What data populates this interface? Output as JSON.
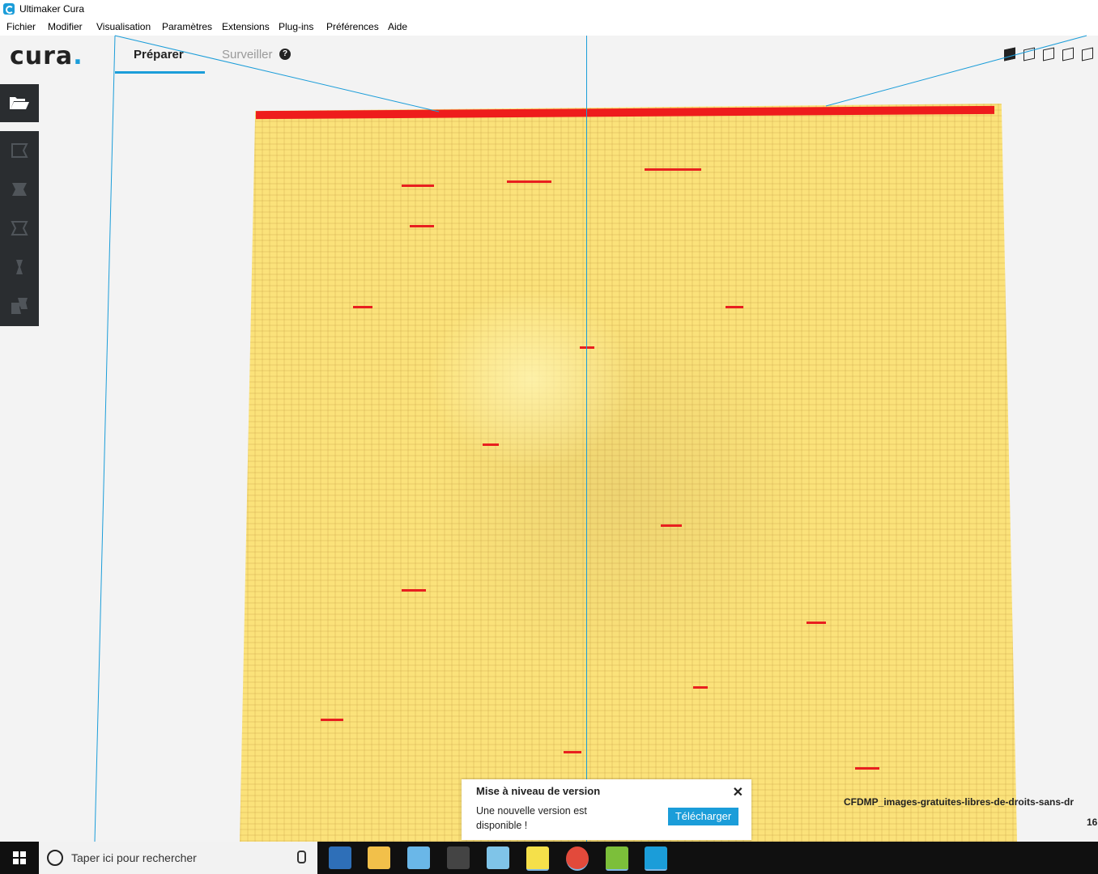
{
  "window": {
    "title": "Ultimaker Cura"
  },
  "menu": [
    "Fichier",
    "Modifier",
    "Visualisation",
    "Paramètres",
    "Extensions",
    "Plug-ins",
    "Préférences",
    "Aide"
  ],
  "header": {
    "logo_text": "cura",
    "tabs": [
      {
        "label": "Préparer",
        "active": true
      },
      {
        "label": "Surveiller",
        "active": false
      }
    ],
    "help_glyph": "?"
  },
  "view_icons": [
    "3d-view-icon",
    "front-view-icon",
    "top-view-icon",
    "left-view-icon",
    "right-view-icon"
  ],
  "sidebar": {
    "open_file": "folder-open-icon",
    "tools": [
      "move-tool-icon",
      "scale-tool-icon",
      "rotate-tool-icon",
      "mirror-tool-icon",
      "per-model-settings-icon"
    ]
  },
  "popup": {
    "title": "Mise à niveau de version",
    "message": "Une nouvelle version est disponible !",
    "button": "Télécharger",
    "close_glyph": "✕"
  },
  "status": {
    "filename": "CFDMP_images-gratuites-libres-de-droits-sans-dr",
    "count": "16"
  },
  "taskbar": {
    "search_placeholder": "Taper ici pour rechercher",
    "apps": [
      "contacts-icon",
      "file-explorer-icon",
      "paint-icon",
      "calculator-icon",
      "notes-icon",
      "sticky-notes-icon",
      "chrome-icon",
      "bluestacks-icon",
      "cura-icon"
    ]
  },
  "colors": {
    "accent": "#1b9dd9",
    "model": "#fbe27a",
    "overhang": "#ee1c1c",
    "dark_panel": "#2a2d30"
  }
}
